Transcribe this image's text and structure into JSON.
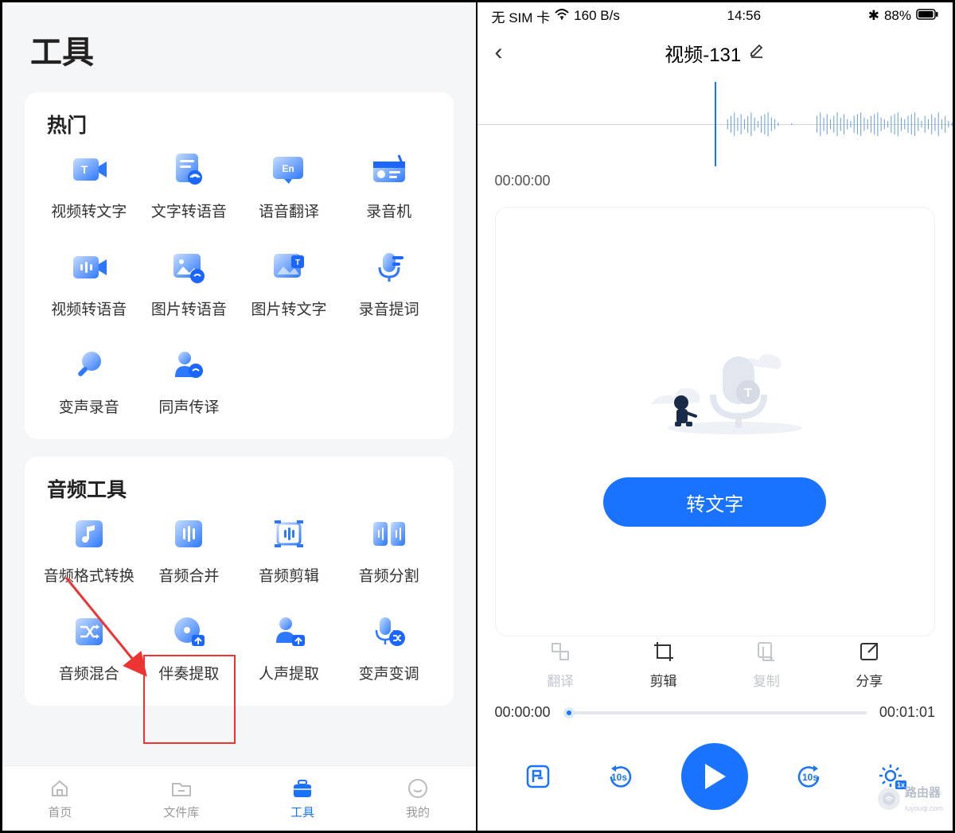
{
  "left": {
    "title": "工具",
    "section1": {
      "title": "热门",
      "items": [
        {
          "label": "视频转文字"
        },
        {
          "label": "文字转语音"
        },
        {
          "label": "语音翻译"
        },
        {
          "label": "录音机"
        },
        {
          "label": "视频转语音"
        },
        {
          "label": "图片转语音"
        },
        {
          "label": "图片转文字"
        },
        {
          "label": "录音提词"
        },
        {
          "label": "变声录音"
        },
        {
          "label": "同声传译"
        }
      ]
    },
    "section2": {
      "title": "音频工具",
      "items": [
        {
          "label": "音频格式转换"
        },
        {
          "label": "音频合并"
        },
        {
          "label": "音频剪辑"
        },
        {
          "label": "音频分割"
        },
        {
          "label": "音频混合"
        },
        {
          "label": "伴奏提取"
        },
        {
          "label": "人声提取"
        },
        {
          "label": "变声变调"
        }
      ]
    },
    "tabs": [
      {
        "label": "首页"
      },
      {
        "label": "文件库"
      },
      {
        "label": "工具"
      },
      {
        "label": "我的"
      }
    ]
  },
  "right": {
    "status": {
      "sim": "无 SIM 卡",
      "speed": "160 B/s",
      "time": "14:56",
      "battery": "88%"
    },
    "header": {
      "title": "视频-131"
    },
    "timestamp": "00:00:00",
    "cta": "转文字",
    "actions": [
      {
        "label": "翻译"
      },
      {
        "label": "剪辑"
      },
      {
        "label": "复制"
      },
      {
        "label": "分享"
      }
    ],
    "progress": {
      "start": "00:00:00",
      "end": "00:01:01"
    },
    "seek": {
      "back": "10s",
      "fwd": "10s"
    },
    "watermark": "路由器"
  }
}
